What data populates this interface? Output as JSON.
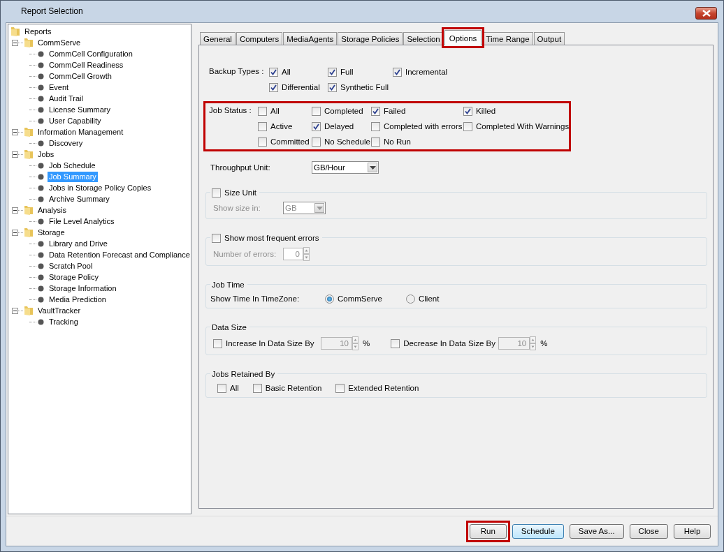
{
  "window": {
    "title": "Report Selection"
  },
  "tree": {
    "label": "Reports",
    "selected": false,
    "children": [
      {
        "label": "CommServe",
        "expanded": true,
        "selected": false,
        "children": [
          {
            "label": "CommCell Configuration",
            "selected": false
          },
          {
            "label": "CommCell Readiness",
            "selected": false
          },
          {
            "label": "CommCell Growth",
            "selected": false
          },
          {
            "label": "Event",
            "selected": false
          },
          {
            "label": "Audit Trail",
            "selected": false
          },
          {
            "label": "License Summary",
            "selected": false
          },
          {
            "label": "User Capability",
            "selected": false
          }
        ]
      },
      {
        "label": "Information Management",
        "expanded": true,
        "selected": false,
        "children": [
          {
            "label": "Discovery",
            "selected": false
          }
        ]
      },
      {
        "label": "Jobs",
        "expanded": true,
        "selected": false,
        "children": [
          {
            "label": "Job Schedule",
            "selected": false
          },
          {
            "label": "Job Summary",
            "selected": true
          },
          {
            "label": "Jobs in Storage Policy Copies",
            "selected": false
          },
          {
            "label": "Archive Summary",
            "selected": false
          }
        ]
      },
      {
        "label": "Analysis",
        "expanded": true,
        "selected": false,
        "children": [
          {
            "label": "File Level Analytics",
            "selected": false
          }
        ]
      },
      {
        "label": "Storage",
        "expanded": true,
        "selected": false,
        "children": [
          {
            "label": "Library and Drive",
            "selected": false
          },
          {
            "label": "Data Retention Forecast and Compliance",
            "selected": false
          },
          {
            "label": "Scratch Pool",
            "selected": false
          },
          {
            "label": "Storage Policy",
            "selected": false
          },
          {
            "label": "Storage Information",
            "selected": false
          },
          {
            "label": "Media Prediction",
            "selected": false
          }
        ]
      },
      {
        "label": "VaultTracker",
        "expanded": true,
        "selected": false,
        "children": [
          {
            "label": "Tracking",
            "selected": false
          }
        ]
      }
    ]
  },
  "tabs": [
    {
      "label": "General",
      "selected": false,
      "highlighted": false
    },
    {
      "label": "Computers",
      "selected": false,
      "highlighted": false
    },
    {
      "label": "MediaAgents",
      "selected": false,
      "highlighted": false
    },
    {
      "label": "Storage Policies",
      "selected": false,
      "highlighted": false
    },
    {
      "label": "Selection",
      "selected": false,
      "highlighted": false
    },
    {
      "label": "Options",
      "selected": true,
      "highlighted": true
    },
    {
      "label": "Time Range",
      "selected": false,
      "highlighted": false
    },
    {
      "label": "Output",
      "selected": false,
      "highlighted": false
    }
  ],
  "backup_types": {
    "label": "Backup Types :",
    "highlighted": false,
    "options": [
      {
        "label": "All",
        "checked": true
      },
      {
        "label": "Full",
        "checked": true
      },
      {
        "label": "Incremental",
        "checked": true
      },
      {
        "label": "Differential",
        "checked": true
      },
      {
        "label": "Synthetic Full",
        "checked": true
      }
    ]
  },
  "job_status": {
    "label": "Job Status :",
    "highlighted": true,
    "options": [
      {
        "label": "All",
        "checked": false
      },
      {
        "label": "Completed",
        "checked": false
      },
      {
        "label": "Failed",
        "checked": true
      },
      {
        "label": "Killed",
        "checked": true
      },
      {
        "label": "Active",
        "checked": false
      },
      {
        "label": "Delayed",
        "checked": true
      },
      {
        "label": "Completed with errors",
        "checked": false
      },
      {
        "label": "Completed With Warnings",
        "checked": false
      },
      {
        "label": "Committed",
        "checked": false
      },
      {
        "label": "No Schedule",
        "checked": false
      },
      {
        "label": "No Run",
        "checked": false
      }
    ]
  },
  "throughput": {
    "label": "Throughput Unit:",
    "value": "GB/Hour"
  },
  "size_unit": {
    "label": "Size Unit",
    "checked": false,
    "field_label": "Show size in:",
    "value": "GB"
  },
  "frequent_errors": {
    "label": "Show most frequent errors",
    "checked": false,
    "field_label": "Number of errors:",
    "value": "0"
  },
  "job_time": {
    "title": "Job Time",
    "label": "Show Time In TimeZone:",
    "options": [
      {
        "label": "CommServe",
        "selected": true
      },
      {
        "label": "Client",
        "selected": false
      }
    ]
  },
  "data_size": {
    "title": "Data Size",
    "items": [
      {
        "label": "Increase In Data Size By",
        "checked": false,
        "value": "10",
        "unit": "%"
      },
      {
        "label": "Decrease In Data Size By",
        "checked": false,
        "value": "10",
        "unit": "%"
      }
    ]
  },
  "jobs_retained": {
    "title": "Jobs Retained By",
    "options": [
      {
        "label": "All",
        "checked": false
      },
      {
        "label": "Basic Retention",
        "checked": false
      },
      {
        "label": "Extended Retention",
        "checked": false
      }
    ]
  },
  "buttons": [
    {
      "label": "Run",
      "highlighted": true,
      "focused": false
    },
    {
      "label": "Schedule",
      "highlighted": false,
      "focused": true
    },
    {
      "label": "Save As...",
      "highlighted": false,
      "focused": false
    },
    {
      "label": "Close",
      "highlighted": false,
      "focused": false
    },
    {
      "label": "Help",
      "highlighted": false,
      "focused": false
    }
  ]
}
